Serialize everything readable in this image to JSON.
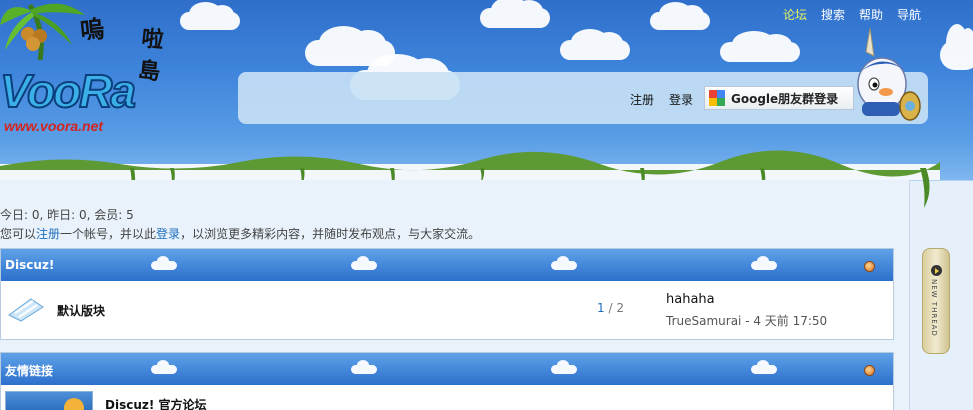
{
  "logo": {
    "wordmark": "VooRa",
    "url": "www.voora.net",
    "cn_title_1": "嗚",
    "cn_title_2": "啦島"
  },
  "top_nav": {
    "items": [
      {
        "label": "论坛",
        "active": true
      },
      {
        "label": "搜索",
        "active": false
      },
      {
        "label": "帮助",
        "active": false
      },
      {
        "label": "导航",
        "active": false
      }
    ]
  },
  "login_bar": {
    "register_label": "注册",
    "login_label": "登录",
    "google_label": "Google朋友群登录",
    "google_icon": "google-friend-connect-icon"
  },
  "stats": {
    "text": "今日: 0, 昨日: 0, 会员: 5"
  },
  "welcome": {
    "prefix": "您可以",
    "register_link": "注册",
    "middle": "一个帐号，并以此",
    "login_link": "登录",
    "suffix": "，以浏览更多精彩内容，并随时发布观点，与大家交流。"
  },
  "category_discuz": {
    "title": "Discuz!",
    "forums": [
      {
        "name": "默认版块",
        "threads": "1",
        "separator": " / ",
        "posts": "2",
        "last_post_title": "hahaha",
        "last_post_author": "TrueSamurai",
        "last_post_time": " - 4 天前 17:50"
      }
    ]
  },
  "category_links": {
    "title": "友情链接",
    "links": [
      {
        "name": "Discuz! 官方论坛"
      }
    ]
  },
  "side_tab": {
    "label": "NEW THREAD"
  },
  "colors": {
    "header_blue": "#2c70cc",
    "active_nav": "#e7f45c",
    "link_blue": "#1f6fbf"
  }
}
